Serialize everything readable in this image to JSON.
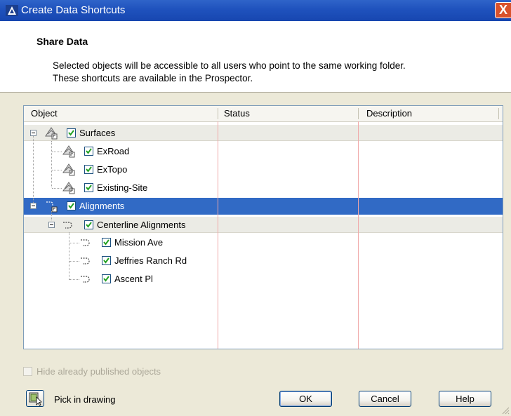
{
  "window": {
    "title": "Create Data Shortcuts",
    "close_glyph": "X"
  },
  "header": {
    "title": "Share Data",
    "description_line1": "Selected objects will be accessible to all users who point to the same working folder.",
    "description_line2": "These shortcuts are available in the Prospector."
  },
  "grid": {
    "columns": [
      "Object",
      "Status",
      "Description"
    ],
    "rows": [
      {
        "label": "Surfaces",
        "checked": true,
        "icon": "surface-icon",
        "expanded": true
      },
      {
        "label": "ExRoad",
        "checked": true,
        "icon": "surface-icon"
      },
      {
        "label": "ExTopo",
        "checked": true,
        "icon": "surface-icon"
      },
      {
        "label": "Existing-Site",
        "checked": true,
        "icon": "surface-icon"
      },
      {
        "label": "Alignments",
        "checked": true,
        "icon": "alignment-icon",
        "expanded": true,
        "selected": true
      },
      {
        "label": "Centerline Alignments",
        "checked": true,
        "icon": "alignment-icon",
        "expanded": true
      },
      {
        "label": "Mission Ave",
        "checked": true,
        "icon": "alignment-icon"
      },
      {
        "label": "Jeffries Ranch Rd",
        "checked": true,
        "icon": "alignment-icon"
      },
      {
        "label": "Ascent Pl",
        "checked": true,
        "icon": "alignment-icon"
      }
    ]
  },
  "options": {
    "hide_published_label": "Hide already published objects",
    "hide_published_checked": false
  },
  "footer": {
    "pick_label": "Pick in drawing",
    "ok_label": "OK",
    "cancel_label": "Cancel",
    "help_label": "Help"
  },
  "colors": {
    "titlebar": "#1f52bd",
    "selection": "#316ac5",
    "close": "#d9522c"
  }
}
